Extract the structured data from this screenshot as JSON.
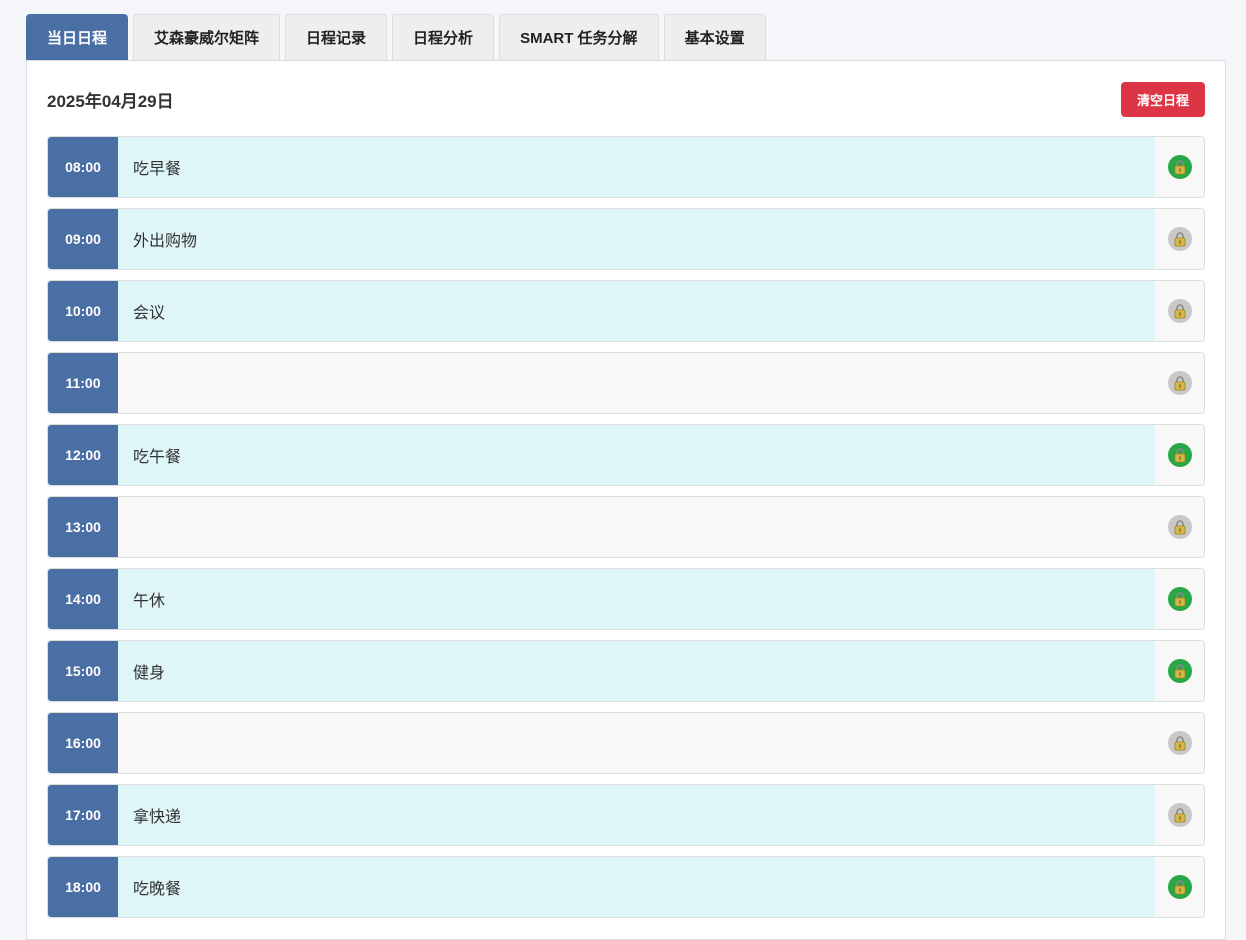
{
  "tabs": [
    {
      "label": "当日日程",
      "active": true
    },
    {
      "label": "艾森豪威尔矩阵",
      "active": false
    },
    {
      "label": "日程记录",
      "active": false
    },
    {
      "label": "日程分析",
      "active": false
    },
    {
      "label": "SMART 任务分解",
      "active": false
    },
    {
      "label": "基本设置",
      "active": false
    }
  ],
  "header": {
    "date": "2025年04月29日",
    "clear_label": "清空日程"
  },
  "schedule": [
    {
      "time": "08:00",
      "task": "吃早餐",
      "locked": true
    },
    {
      "time": "09:00",
      "task": "外出购物",
      "locked": false
    },
    {
      "time": "10:00",
      "task": "会议",
      "locked": false
    },
    {
      "time": "11:00",
      "task": "",
      "locked": false
    },
    {
      "time": "12:00",
      "task": "吃午餐",
      "locked": true
    },
    {
      "time": "13:00",
      "task": "",
      "locked": false
    },
    {
      "time": "14:00",
      "task": "午休",
      "locked": true
    },
    {
      "time": "15:00",
      "task": "健身",
      "locked": true
    },
    {
      "time": "16:00",
      "task": "",
      "locked": false
    },
    {
      "time": "17:00",
      "task": "拿快递",
      "locked": false
    },
    {
      "time": "18:00",
      "task": "吃晚餐",
      "locked": true
    }
  ],
  "icons": {
    "lock": "lock-icon"
  },
  "colors": {
    "accent": "#4a6fa5",
    "danger": "#dc3545",
    "filled_task": "#dff6f8",
    "lock_on": "#28a745",
    "lock_off": "#c8c8c8"
  }
}
